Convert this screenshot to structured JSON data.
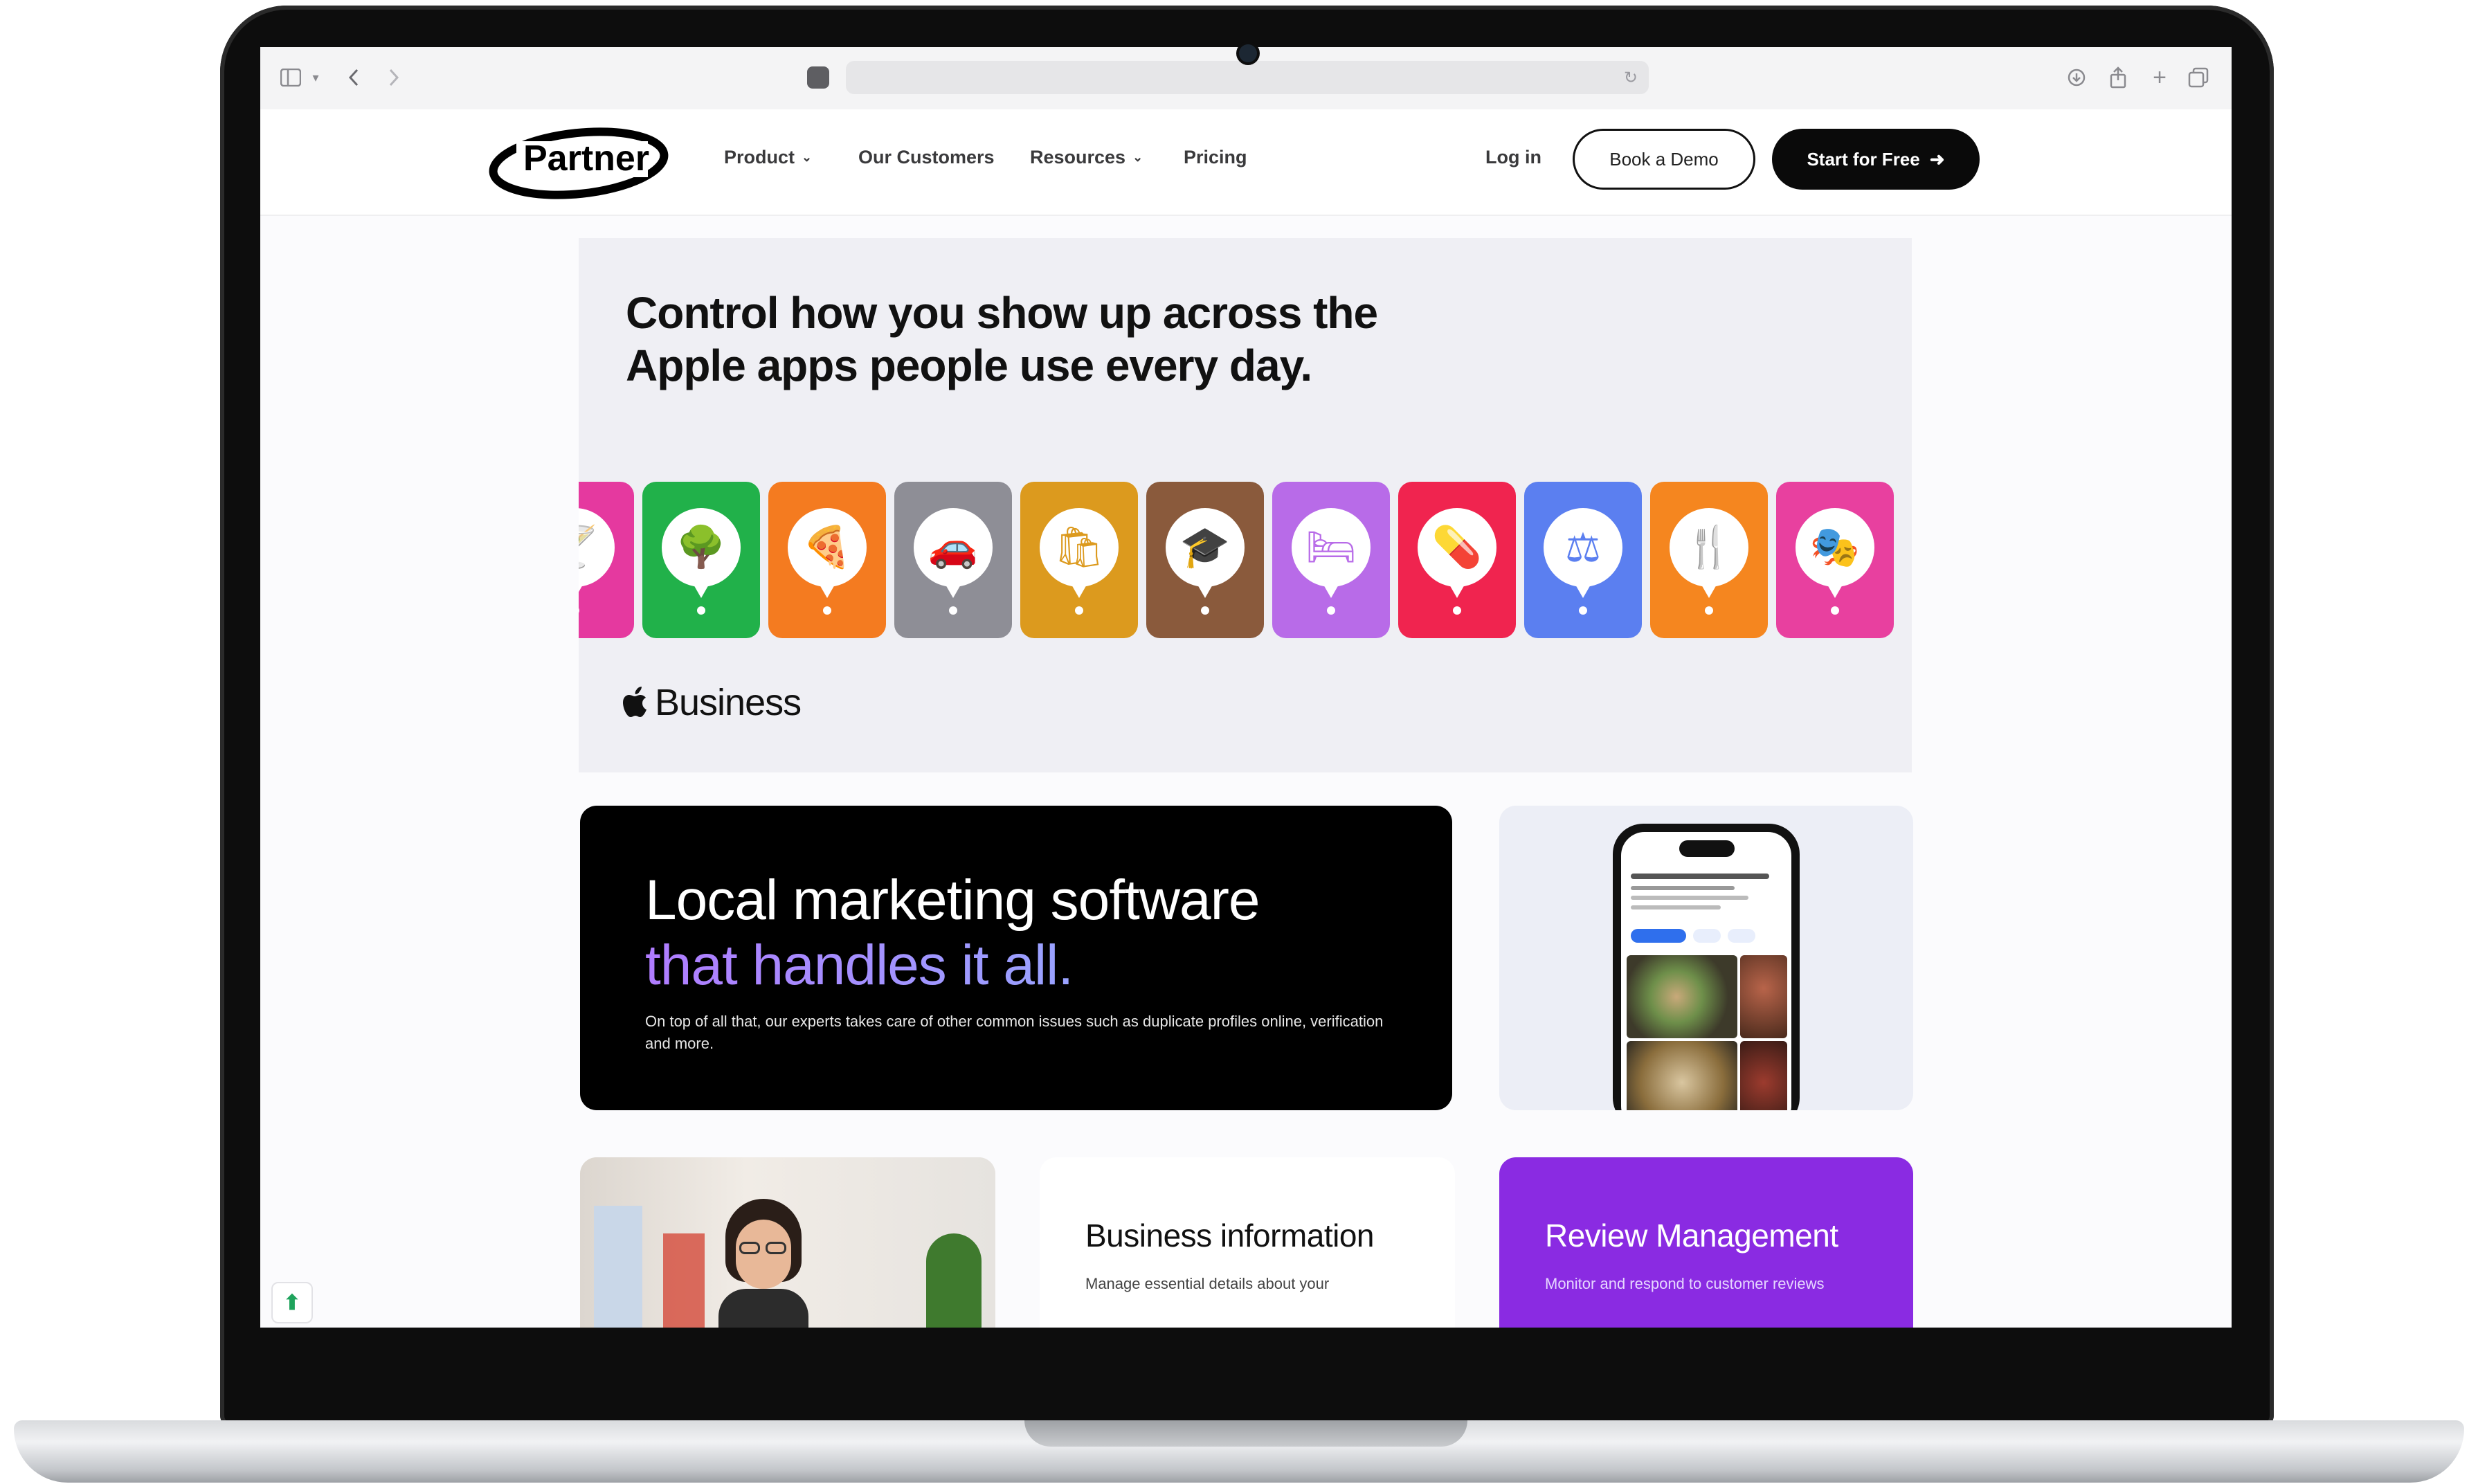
{
  "brand": {
    "name": "Partner",
    "accent": "#000000",
    "purple": "#8a2be2"
  },
  "nav": {
    "items": [
      {
        "label": "Product",
        "has_dropdown": true
      },
      {
        "label": "Our Customers",
        "has_dropdown": false
      },
      {
        "label": "Resources",
        "has_dropdown": true
      },
      {
        "label": "Pricing",
        "has_dropdown": false
      }
    ],
    "login": "Log in",
    "demo": "Book a Demo",
    "start": "Start for Free"
  },
  "apple_banner": {
    "headline_line1": "Control how you show up across the",
    "headline_line2": "Apple apps people use every day.",
    "brand_word": "Business",
    "tiles": [
      {
        "icon": "cocktail-icon",
        "glyph": "🍸",
        "color": "#e5399f"
      },
      {
        "icon": "park-icon",
        "glyph": "🌳",
        "color": "#21b14a"
      },
      {
        "icon": "pizza-icon",
        "glyph": "🍕",
        "color": "#f47b20"
      },
      {
        "icon": "car-icon",
        "glyph": "🚗",
        "color": "#8e8e96"
      },
      {
        "icon": "shopping-bag-icon",
        "glyph": "🛍",
        "color": "#dc9a1e"
      },
      {
        "icon": "graduation-cap-icon",
        "glyph": "🎓",
        "color": "#8a5a3c"
      },
      {
        "icon": "bed-icon",
        "glyph": "🛏",
        "color": "#b86be8"
      },
      {
        "icon": "pill-icon",
        "glyph": "💊",
        "color": "#f0244f"
      },
      {
        "icon": "scales-icon",
        "glyph": "⚖",
        "color": "#5b7ff0"
      },
      {
        "icon": "fork-knife-icon",
        "glyph": "🍴",
        "color": "#f5861f"
      },
      {
        "icon": "theater-mask-icon",
        "glyph": "🎭",
        "color": "#e8409f"
      }
    ]
  },
  "hero": {
    "title_line1": "Local marketing software",
    "title_line2": "that handles it all.",
    "subtitle": "On top of all that, our experts takes care of other common issues such as duplicate profiles online, verification and more."
  },
  "cards": {
    "info_title": "Business information",
    "info_sub": "Manage essential details about your",
    "review_title": "Review Management",
    "review_sub": "Monitor and respond to customer reviews"
  }
}
